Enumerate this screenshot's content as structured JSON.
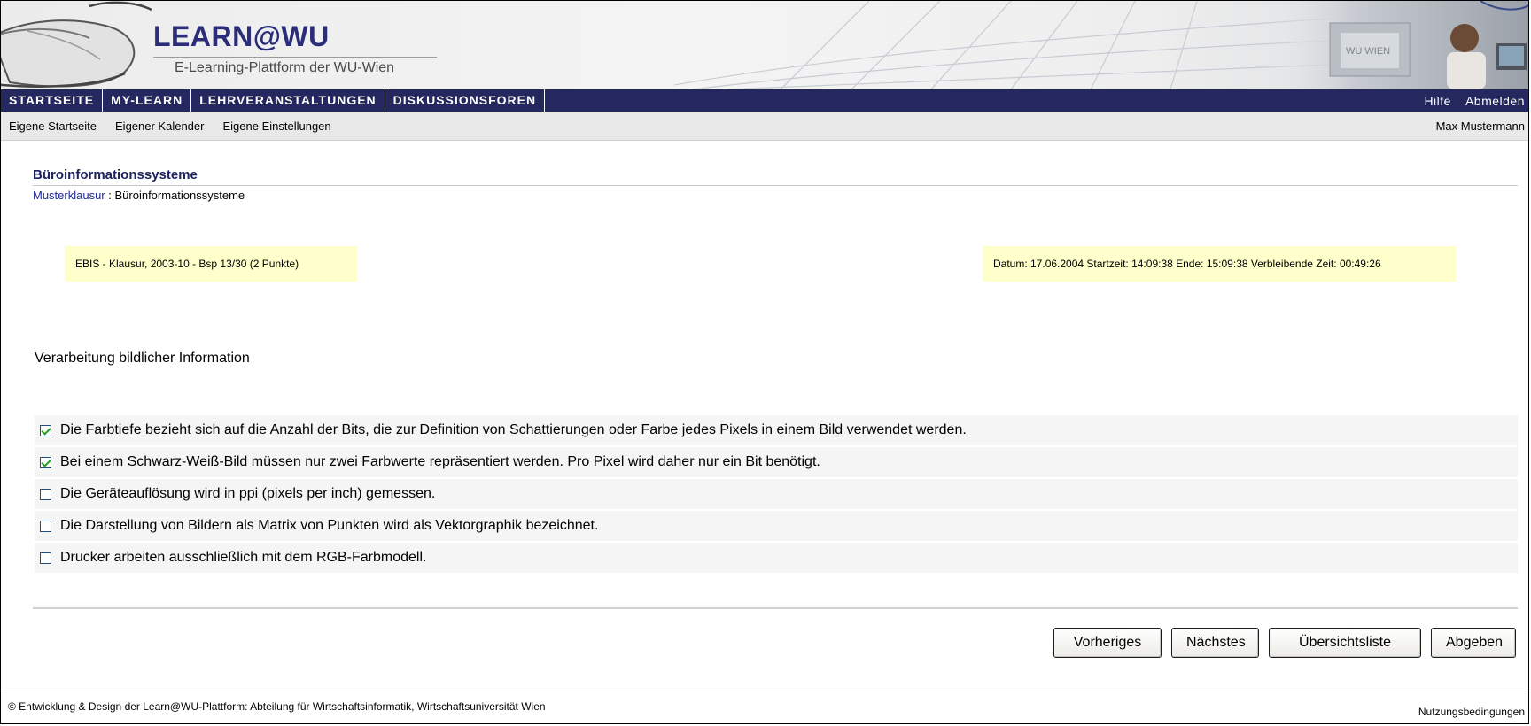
{
  "header": {
    "logo_title": "LEARN@WU",
    "logo_subtitle": "E-Learning-Plattform der WU-Wien",
    "logo_photo_text": "WU WIEN"
  },
  "nav": {
    "items": [
      {
        "label": "STARTSEITE"
      },
      {
        "label": "MY-LEARN"
      },
      {
        "label": "LEHRVERANSTALTUNGEN"
      },
      {
        "label": "DISKUSSIONSFOREN"
      }
    ],
    "help": "Hilfe",
    "logout": "Abmelden"
  },
  "subnav": {
    "links": [
      {
        "label": "Eigene Startseite"
      },
      {
        "label": "Eigener Kalender"
      },
      {
        "label": "Eigene Einstellungen"
      }
    ],
    "user": "Max Mustermann"
  },
  "content": {
    "course_title": "Büroinformationssysteme",
    "breadcrumb_link": "Musterklausur",
    "breadcrumb_sep": " : ",
    "breadcrumb_current": "Büroinformationssysteme",
    "exam_info": "EBIS - Klausur, 2003-10 - Bsp 13/30 (2 Punkte)",
    "time_info": "Datum: 17.06.2004 Startzeit: 14:09:38 Ende: 15:09:38 Verbleibende Zeit: 00:49:26",
    "question": "Verarbeitung bildlicher Information",
    "answers": [
      {
        "text": "Die Farbtiefe bezieht sich auf die Anzahl der Bits, die zur Definition von Schattierungen oder Farbe jedes Pixels in einem Bild verwendet werden.",
        "checked": true
      },
      {
        "text": "Bei einem Schwarz-Weiß-Bild müssen nur zwei Farbwerte repräsentiert werden. Pro Pixel wird daher nur ein Bit benötigt.",
        "checked": true
      },
      {
        "text": "Die Geräteauflösung wird in ppi (pixels per inch) gemessen.",
        "checked": false
      },
      {
        "text": "Die Darstellung von Bildern als Matrix von Punkten wird als Vektorgraphik bezeichnet.",
        "checked": false
      },
      {
        "text": "Drucker arbeiten ausschließlich mit dem RGB-Farbmodell.",
        "checked": false
      }
    ]
  },
  "buttons": {
    "previous": "Vorheriges",
    "next": "Nächstes",
    "overview": "Übersichtsliste",
    "submit": "Abgeben"
  },
  "footer": {
    "copyright": "© Entwicklung & Design der Learn@WU-Plattform: Abteilung für Wirtschaftsinformatik, Wirtschaftsuniversität Wien",
    "terms": "Nutzungsbedingungen"
  },
  "colors": {
    "nav_bg": "#24285e",
    "logo_title": "#2b2d78",
    "info_bg": "#ffffcc",
    "link": "#1f2a9c",
    "check": "#21a121"
  },
  "icons": [
    "computer-mouse-icon",
    "globe-icon",
    "checkbox-icon"
  ]
}
